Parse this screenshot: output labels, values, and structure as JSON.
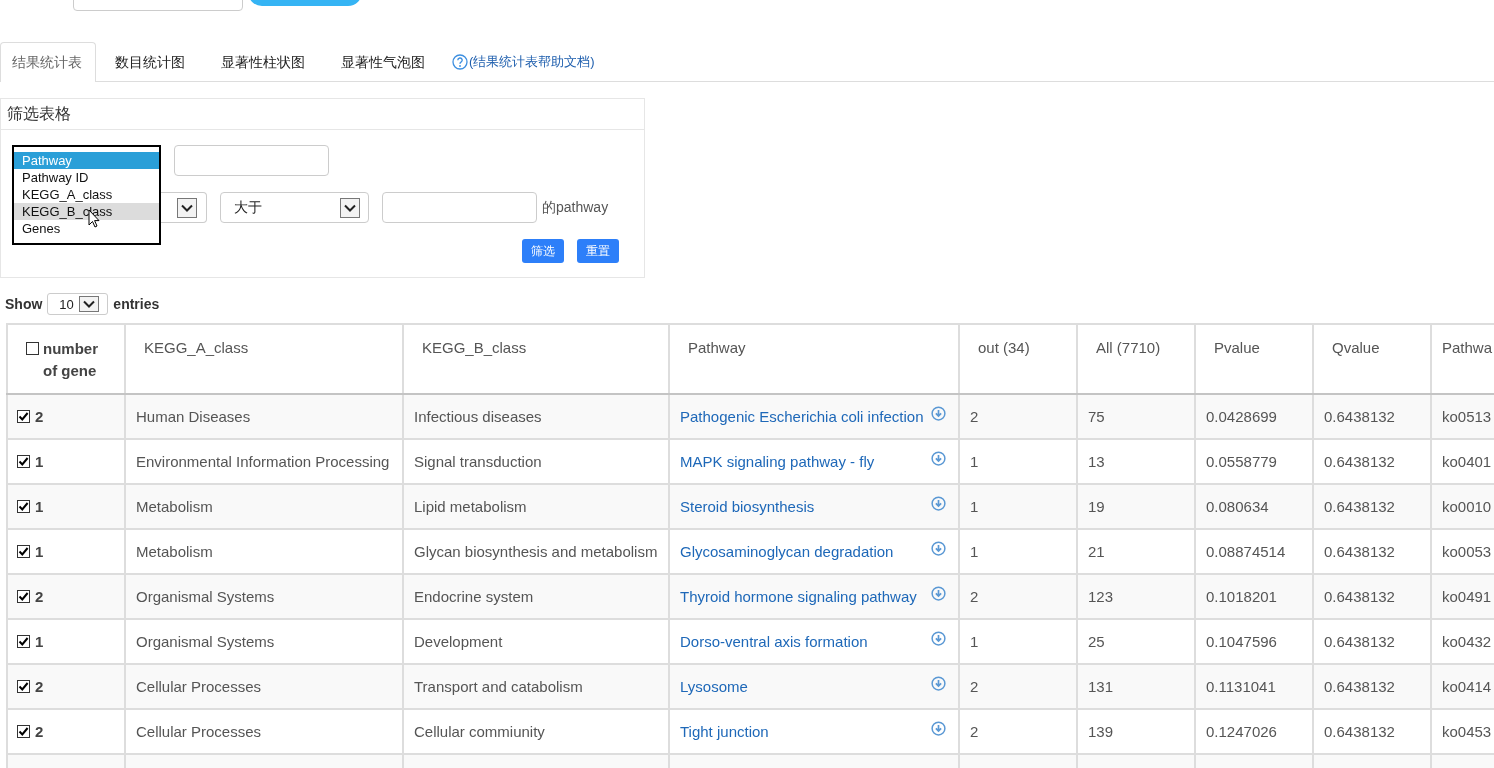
{
  "tabs": [
    {
      "label": "结果统计表",
      "selected": true
    },
    {
      "label": "数目统计图",
      "selected": false
    },
    {
      "label": "显著性柱状图",
      "selected": false
    },
    {
      "label": "显著性气泡图",
      "selected": false
    }
  ],
  "help_link": {
    "label": "(结果统计表帮助文档)"
  },
  "filter_panel": {
    "title": "筛选表格",
    "options": [
      {
        "label": "Pathway",
        "selected": true,
        "hovered": false
      },
      {
        "label": "Pathway ID",
        "selected": false,
        "hovered": false
      },
      {
        "label": "KEGG_A_class",
        "selected": false,
        "hovered": false
      },
      {
        "label": "KEGG_B_class",
        "selected": false,
        "hovered": true
      },
      {
        "label": "Genes",
        "selected": false,
        "hovered": false
      }
    ],
    "comparison": "大于",
    "suffix": "的pathway",
    "buttons": [
      "筛选",
      "重置"
    ]
  },
  "entries": {
    "prefix": "Show",
    "value": "10",
    "suffix": "entries"
  },
  "table": {
    "header_checkbox": {
      "checked": false
    },
    "columns": [
      "number of gene",
      "KEGG_A_class",
      "KEGG_B_class",
      "Pathway",
      "out (34)",
      "All (7710)",
      "Pvalue",
      "Qvalue",
      "Pathwa"
    ],
    "rows": [
      {
        "checked": true,
        "count": "2",
        "a_class": "Human Diseases",
        "b_class": "Infectious diseases",
        "pathway": "Pathogenic Escherichia coli infection",
        "out": "2",
        "all": "75",
        "pvalue": "0.0428699",
        "qvalue": "0.6438132",
        "pathway_id": "ko0513"
      },
      {
        "checked": true,
        "count": "1",
        "a_class": "Environmental Information Processing",
        "b_class": "Signal transduction",
        "pathway": "MAPK signaling pathway - fly",
        "out": "1",
        "all": "13",
        "pvalue": "0.0558779",
        "qvalue": "0.6438132",
        "pathway_id": "ko0401"
      },
      {
        "checked": true,
        "count": "1",
        "a_class": "Metabolism",
        "b_class": "Lipid metabolism",
        "pathway": "Steroid biosynthesis",
        "out": "1",
        "all": "19",
        "pvalue": "0.080634",
        "qvalue": "0.6438132",
        "pathway_id": "ko0010"
      },
      {
        "checked": true,
        "count": "1",
        "a_class": "Metabolism",
        "b_class": "Glycan biosynthesis and metabolism",
        "pathway": "Glycosaminoglycan degradation",
        "out": "1",
        "all": "21",
        "pvalue": "0.08874514",
        "qvalue": "0.6438132",
        "pathway_id": "ko0053"
      },
      {
        "checked": true,
        "count": "2",
        "a_class": "Organismal Systems",
        "b_class": "Endocrine system",
        "pathway": "Thyroid hormone signaling pathway",
        "out": "2",
        "all": "123",
        "pvalue": "0.1018201",
        "qvalue": "0.6438132",
        "pathway_id": "ko0491"
      },
      {
        "checked": true,
        "count": "1",
        "a_class": "Organismal Systems",
        "b_class": "Development",
        "pathway": "Dorso-ventral axis formation",
        "out": "1",
        "all": "25",
        "pvalue": "0.1047596",
        "qvalue": "0.6438132",
        "pathway_id": "ko0432"
      },
      {
        "checked": true,
        "count": "2",
        "a_class": "Cellular Processes",
        "b_class": "Transport and catabolism",
        "pathway": "Lysosome",
        "out": "2",
        "all": "131",
        "pvalue": "0.1131041",
        "qvalue": "0.6438132",
        "pathway_id": "ko0414"
      },
      {
        "checked": true,
        "count": "2",
        "a_class": "Cellular Processes",
        "b_class": "Cellular commiunity",
        "pathway": "Tight junction",
        "out": "2",
        "all": "139",
        "pvalue": "0.1247026",
        "qvalue": "0.6438132",
        "pathway_id": "ko0453"
      }
    ]
  }
}
